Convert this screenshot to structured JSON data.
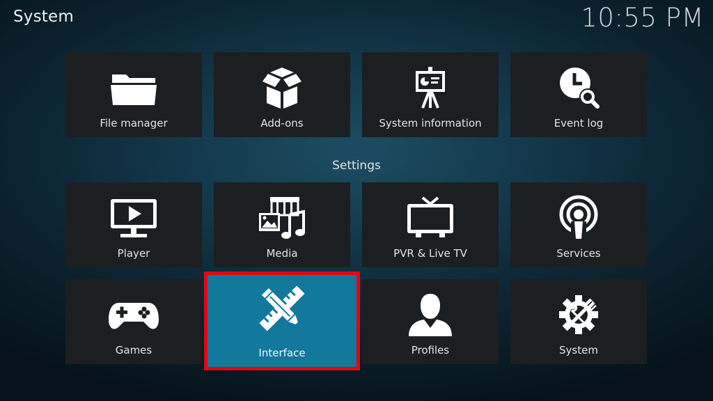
{
  "header": {
    "title": "System",
    "clock": "10:55 PM"
  },
  "top_row": [
    {
      "label": "File manager",
      "icon": "folder-icon"
    },
    {
      "label": "Add-ons",
      "icon": "open-box-icon"
    },
    {
      "label": "System information",
      "icon": "presentation-easel-icon"
    },
    {
      "label": "Event log",
      "icon": "clock-magnifier-icon"
    }
  ],
  "settings": {
    "heading": "Settings",
    "items": [
      {
        "label": "Player",
        "icon": "monitor-play-icon"
      },
      {
        "label": "Media",
        "icon": "media-library-icon"
      },
      {
        "label": "PVR & Live TV",
        "icon": "tv-antenna-icon"
      },
      {
        "label": "Services",
        "icon": "broadcast-icon"
      },
      {
        "label": "Games",
        "icon": "gamepad-icon"
      },
      {
        "label": "Interface",
        "icon": "pencil-ruler-icon",
        "focused": true,
        "highlighted": true
      },
      {
        "label": "Profiles",
        "icon": "person-icon"
      },
      {
        "label": "System",
        "icon": "gear-tools-icon"
      }
    ]
  },
  "colors": {
    "tile_background": "#1b1f22",
    "focused_tile": "#12789c",
    "highlight_border": "#e30613"
  }
}
